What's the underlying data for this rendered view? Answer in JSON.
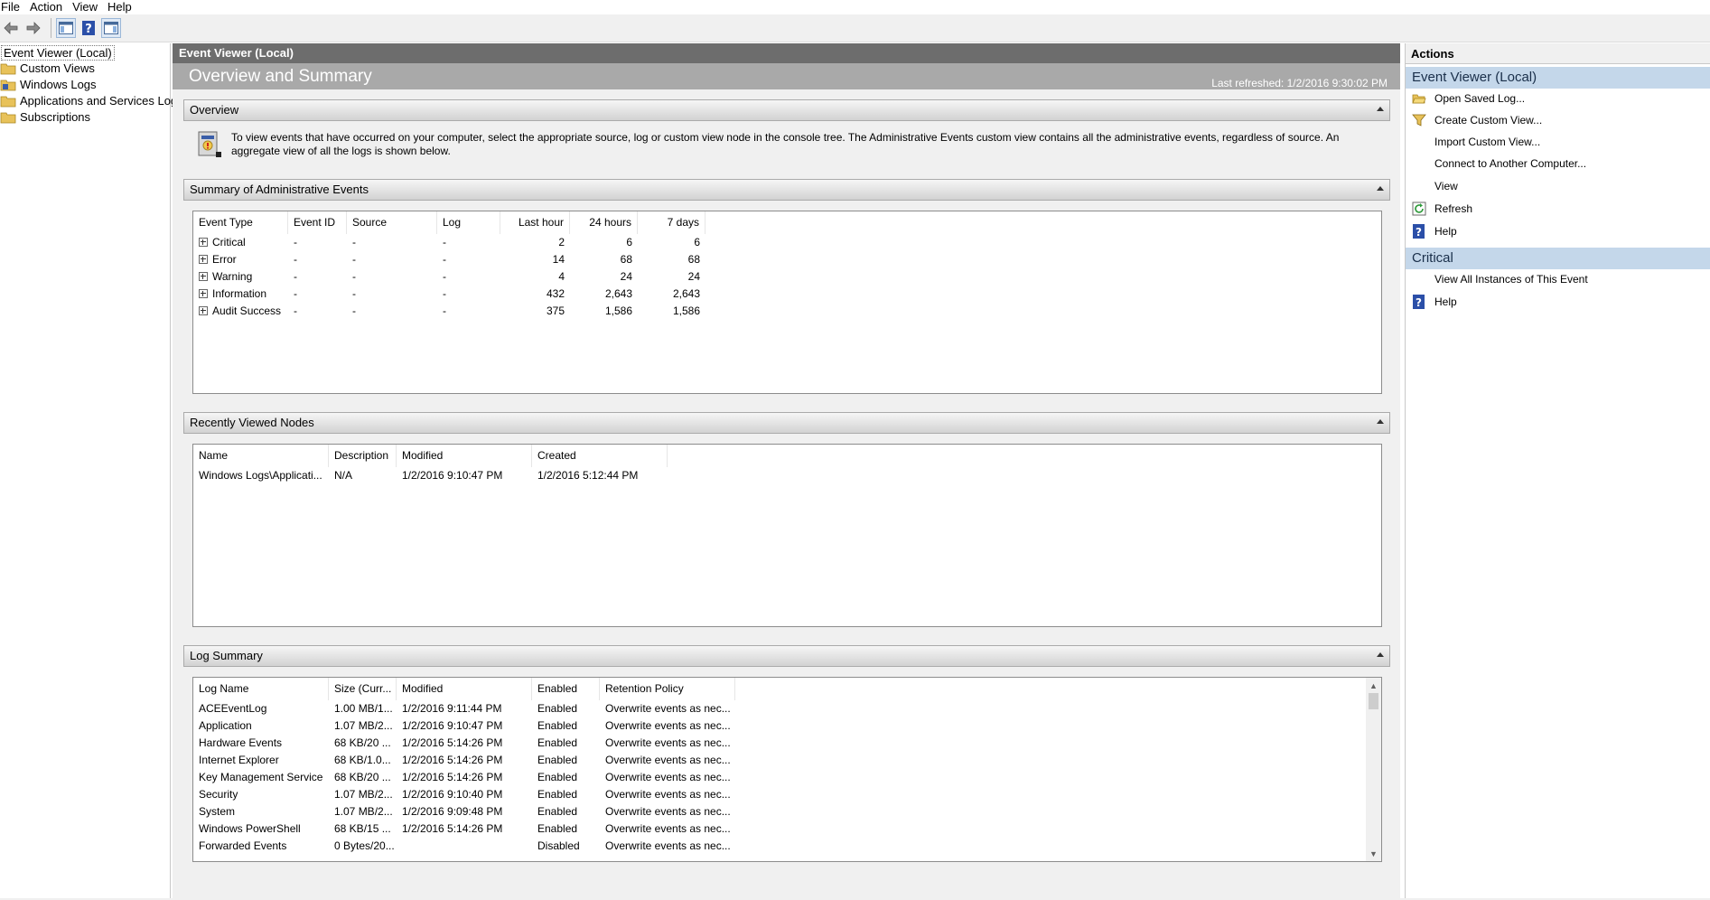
{
  "menu": [
    "File",
    "Action",
    "View",
    "Help"
  ],
  "tree": {
    "items": [
      {
        "label": "Event Viewer (Local)",
        "icon": "event-viewer-icon"
      },
      {
        "label": "Custom Views",
        "icon": "folder-icon"
      },
      {
        "label": "Windows Logs",
        "icon": "folder-icon"
      },
      {
        "label": "Applications and Services Logs",
        "icon": "folder-icon"
      },
      {
        "label": "Subscriptions",
        "icon": "folder-icon"
      }
    ]
  },
  "center": {
    "header": "Event Viewer (Local)",
    "banner_title": "Overview and Summary",
    "last_refreshed": "Last refreshed: 1/2/2016 9:30:02 PM"
  },
  "overview": {
    "title": "Overview",
    "text": "To view events that have occurred on your computer, select the appropriate source, log or custom view node in the console tree. The Administrative Events custom view contains all the administrative events, regardless of source. An aggregate view of all the logs is shown below."
  },
  "admin_summary": {
    "title": "Summary of Administrative Events",
    "columns": [
      "Event Type",
      "Event ID",
      "Source",
      "Log",
      "Last hour",
      "24 hours",
      "7 days"
    ],
    "rows": [
      [
        "Critical",
        "-",
        "-",
        "-",
        "2",
        "6",
        "6"
      ],
      [
        "Error",
        "-",
        "-",
        "-",
        "14",
        "68",
        "68"
      ],
      [
        "Warning",
        "-",
        "-",
        "-",
        "4",
        "24",
        "24"
      ],
      [
        "Information",
        "-",
        "-",
        "-",
        "432",
        "2,643",
        "2,643"
      ],
      [
        "Audit Success",
        "-",
        "-",
        "-",
        "375",
        "1,586",
        "1,586"
      ]
    ]
  },
  "recent_nodes": {
    "title": "Recently Viewed Nodes",
    "columns": [
      "Name",
      "Description",
      "Modified",
      "Created"
    ],
    "rows": [
      [
        "Windows Logs\\Applicati...",
        "N/A",
        "1/2/2016 9:10:47 PM",
        "1/2/2016 5:12:44 PM"
      ]
    ]
  },
  "log_summary": {
    "title": "Log Summary",
    "columns": [
      "Log Name",
      "Size (Curr...",
      "Modified",
      "Enabled",
      "Retention Policy"
    ],
    "rows": [
      [
        "ACEEventLog",
        "1.00 MB/1...",
        "1/2/2016 9:11:44 PM",
        "Enabled",
        "Overwrite events as nec..."
      ],
      [
        "Application",
        "1.07 MB/2...",
        "1/2/2016 9:10:47 PM",
        "Enabled",
        "Overwrite events as nec..."
      ],
      [
        "Hardware Events",
        "68 KB/20 ...",
        "1/2/2016 5:14:26 PM",
        "Enabled",
        "Overwrite events as nec..."
      ],
      [
        "Internet Explorer",
        "68 KB/1.0...",
        "1/2/2016 5:14:26 PM",
        "Enabled",
        "Overwrite events as nec..."
      ],
      [
        "Key Management Service",
        "68 KB/20 ...",
        "1/2/2016 5:14:26 PM",
        "Enabled",
        "Overwrite events as nec..."
      ],
      [
        "Security",
        "1.07 MB/2...",
        "1/2/2016 9:10:40 PM",
        "Enabled",
        "Overwrite events as nec..."
      ],
      [
        "System",
        "1.07 MB/2...",
        "1/2/2016 9:09:48 PM",
        "Enabled",
        "Overwrite events as nec..."
      ],
      [
        "Windows PowerShell",
        "68 KB/15 ...",
        "1/2/2016 5:14:26 PM",
        "Enabled",
        "Overwrite events as nec..."
      ],
      [
        "Forwarded Events",
        "0 Bytes/20...",
        "",
        "Disabled",
        "Overwrite events as nec..."
      ]
    ]
  },
  "actions": {
    "header": "Actions",
    "groups": [
      {
        "title": "Event Viewer (Local)",
        "items": [
          {
            "label": "Open Saved Log...",
            "icon": "open-folder-icon"
          },
          {
            "label": "Create Custom View...",
            "icon": "filter-icon"
          },
          {
            "label": "Import Custom View...",
            "icon": ""
          },
          {
            "label": "Connect to Another Computer...",
            "icon": ""
          },
          {
            "label": "View",
            "icon": ""
          },
          {
            "label": "Refresh",
            "icon": "refresh-icon"
          },
          {
            "label": "Help",
            "icon": "help-icon"
          }
        ]
      },
      {
        "title": "Critical",
        "items": [
          {
            "label": "View All Instances of This Event",
            "icon": ""
          },
          {
            "label": "Help",
            "icon": "help-icon"
          }
        ]
      }
    ]
  },
  "colors": {
    "center_header": "#6d6d6d",
    "banner": "#a9a9a9",
    "action_group": "#c4d7ea",
    "help_blue": "#2b4fa8"
  }
}
